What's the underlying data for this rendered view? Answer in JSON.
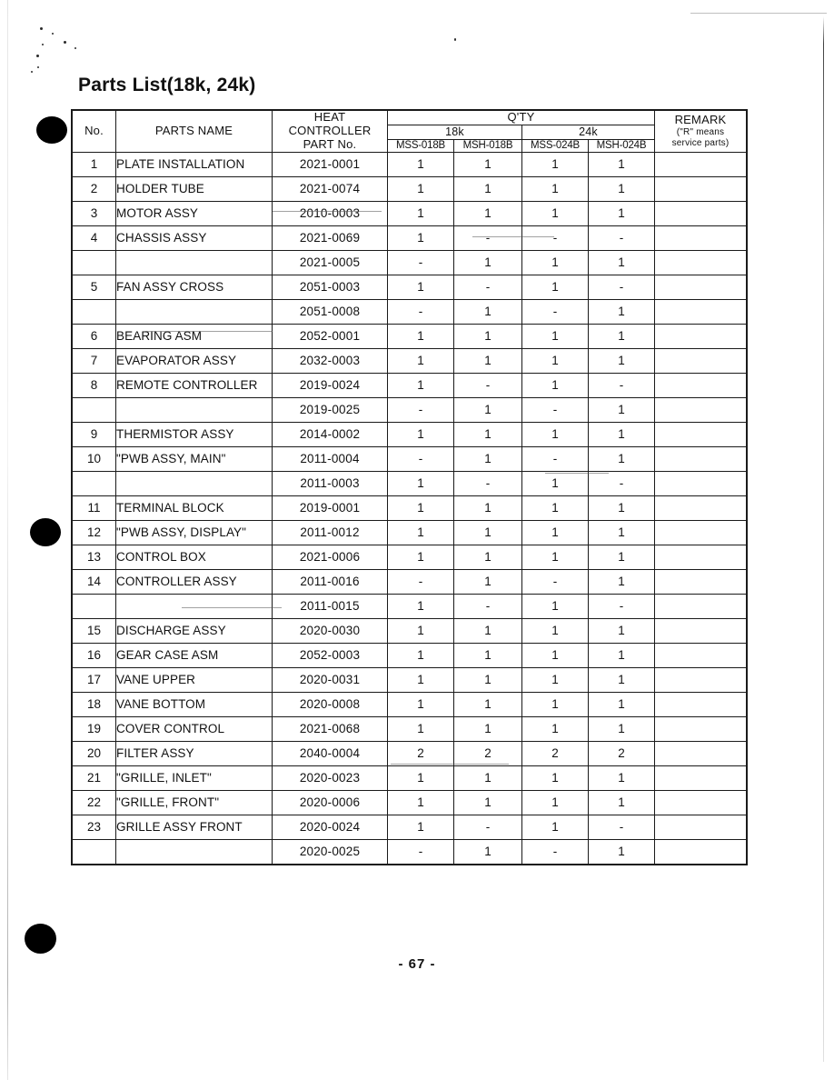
{
  "document": {
    "title": "Parts List(18k, 24k)",
    "page_number": "- 67 -"
  },
  "table": {
    "headers": {
      "no": "No.",
      "parts_name": "PARTS NAME",
      "heat_controller_part_no": "HEAT\nCONTROLLER\nPART No.",
      "heat_controller_line1": "HEAT",
      "heat_controller_line2": "CONTROLLER",
      "heat_controller_line3": "PART No.",
      "qty": "Q'TY",
      "cap_18k": "18k",
      "cap_24k": "24k",
      "model_mss_018b": "MSS-018B",
      "model_msh_018b": "MSH-018B",
      "model_mss_024b": "MSS-024B",
      "model_msh_024b": "MSH-024B",
      "remark": "REMARK",
      "remark_sub_line1": "(\"R\" means",
      "remark_sub_line2": "service parts)"
    },
    "rows": [
      {
        "no": "1",
        "name": "PLATE INSTALLATION",
        "part": "2021-0001",
        "q1": "1",
        "q2": "1",
        "q3": "1",
        "q4": "1",
        "remark": ""
      },
      {
        "no": "2",
        "name": "HOLDER TUBE",
        "part": "2021-0074",
        "q1": "1",
        "q2": "1",
        "q3": "1",
        "q4": "1",
        "remark": ""
      },
      {
        "no": "3",
        "name": "MOTOR ASSY",
        "part": "2010-0003",
        "q1": "1",
        "q2": "1",
        "q3": "1",
        "q4": "1",
        "remark": ""
      },
      {
        "no": "4",
        "name": "CHASSIS ASSY",
        "part": "2021-0069",
        "q1": "1",
        "q2": "-",
        "q3": "-",
        "q4": "-",
        "remark": ""
      },
      {
        "no": "",
        "name": "",
        "part": "2021-0005",
        "q1": "-",
        "q2": "1",
        "q3": "1",
        "q4": "1",
        "remark": ""
      },
      {
        "no": "5",
        "name": "FAN ASSY CROSS",
        "part": "2051-0003",
        "q1": "1",
        "q2": "-",
        "q3": "1",
        "q4": "-",
        "remark": ""
      },
      {
        "no": "",
        "name": "",
        "part": "2051-0008",
        "q1": "-",
        "q2": "1",
        "q3": "-",
        "q4": "1",
        "remark": ""
      },
      {
        "no": "6",
        "name": "BEARING ASM",
        "part": "2052-0001",
        "q1": "1",
        "q2": "1",
        "q3": "1",
        "q4": "1",
        "remark": ""
      },
      {
        "no": "7",
        "name": "EVAPORATOR ASSY",
        "part": "2032-0003",
        "q1": "1",
        "q2": "1",
        "q3": "1",
        "q4": "1",
        "remark": ""
      },
      {
        "no": "8",
        "name": "REMOTE CONTROLLER",
        "part": "2019-0024",
        "q1": "1",
        "q2": "-",
        "q3": "1",
        "q4": "-",
        "remark": ""
      },
      {
        "no": "",
        "name": "",
        "part": "2019-0025",
        "q1": "-",
        "q2": "1",
        "q3": "-",
        "q4": "1",
        "remark": ""
      },
      {
        "no": "9",
        "name": "THERMISTOR ASSY",
        "part": "2014-0002",
        "q1": "1",
        "q2": "1",
        "q3": "1",
        "q4": "1",
        "remark": ""
      },
      {
        "no": "10",
        "name": "\"PWB ASSY, MAIN\"",
        "part": "2011-0004",
        "q1": "-",
        "q2": "1",
        "q3": "-",
        "q4": "1",
        "remark": ""
      },
      {
        "no": "",
        "name": "",
        "part": "2011-0003",
        "q1": "1",
        "q2": "-",
        "q3": "1",
        "q4": "-",
        "remark": ""
      },
      {
        "no": "11",
        "name": "TERMINAL BLOCK",
        "part": "2019-0001",
        "q1": "1",
        "q2": "1",
        "q3": "1",
        "q4": "1",
        "remark": ""
      },
      {
        "no": "12",
        "name": "\"PWB ASSY, DISPLAY\"",
        "part": "2011-0012",
        "q1": "1",
        "q2": "1",
        "q3": "1",
        "q4": "1",
        "remark": ""
      },
      {
        "no": "13",
        "name": "CONTROL BOX",
        "part": "2021-0006",
        "q1": "1",
        "q2": "1",
        "q3": "1",
        "q4": "1",
        "remark": ""
      },
      {
        "no": "14",
        "name": "CONTROLLER ASSY",
        "part": "2011-0016",
        "q1": "-",
        "q2": "1",
        "q3": "-",
        "q4": "1",
        "remark": ""
      },
      {
        "no": "",
        "name": "",
        "part": "2011-0015",
        "q1": "1",
        "q2": "-",
        "q3": "1",
        "q4": "-",
        "remark": ""
      },
      {
        "no": "15",
        "name": "DISCHARGE ASSY",
        "part": "2020-0030",
        "q1": "1",
        "q2": "1",
        "q3": "1",
        "q4": "1",
        "remark": ""
      },
      {
        "no": "16",
        "name": "GEAR CASE ASM",
        "part": "2052-0003",
        "q1": "1",
        "q2": "1",
        "q3": "1",
        "q4": "1",
        "remark": ""
      },
      {
        "no": "17",
        "name": "VANE UPPER",
        "part": "2020-0031",
        "q1": "1",
        "q2": "1",
        "q3": "1",
        "q4": "1",
        "remark": ""
      },
      {
        "no": "18",
        "name": "VANE BOTTOM",
        "part": "2020-0008",
        "q1": "1",
        "q2": "1",
        "q3": "1",
        "q4": "1",
        "remark": ""
      },
      {
        "no": "19",
        "name": "COVER CONTROL",
        "part": "2021-0068",
        "q1": "1",
        "q2": "1",
        "q3": "1",
        "q4": "1",
        "remark": ""
      },
      {
        "no": "20",
        "name": "FILTER ASSY",
        "part": "2040-0004",
        "q1": "2",
        "q2": "2",
        "q3": "2",
        "q4": "2",
        "remark": ""
      },
      {
        "no": "21",
        "name": "\"GRILLE, INLET\"",
        "part": "2020-0023",
        "q1": "1",
        "q2": "1",
        "q3": "1",
        "q4": "1",
        "remark": ""
      },
      {
        "no": "22",
        "name": "\"GRILLE, FRONT\"",
        "part": "2020-0006",
        "q1": "1",
        "q2": "1",
        "q3": "1",
        "q4": "1",
        "remark": ""
      },
      {
        "no": "23",
        "name": "GRILLE ASSY FRONT",
        "part": "2020-0024",
        "q1": "1",
        "q2": "-",
        "q3": "1",
        "q4": "-",
        "remark": ""
      },
      {
        "no": "",
        "name": "",
        "part": "2020-0025",
        "q1": "-",
        "q2": "1",
        "q3": "-",
        "q4": "1",
        "remark": ""
      }
    ]
  }
}
